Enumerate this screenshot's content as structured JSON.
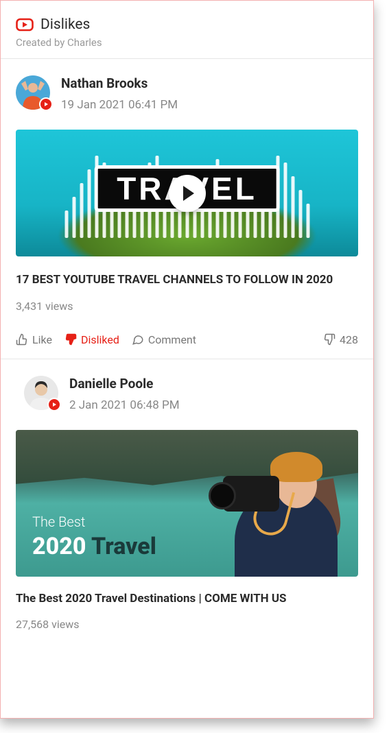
{
  "header": {
    "title": "Dislikes",
    "subtitle": "Created by Charles"
  },
  "posts": [
    {
      "author": "Nathan Brooks",
      "timestamp": "19 Jan 2021 06:41 PM",
      "thumb_word": "TRAVEL",
      "title": "17 BEST YOUTUBE TRAVEL CHANNELS TO FOLLOW IN 2020",
      "views": "3,431 views",
      "actions": {
        "like_label": "Like",
        "dislike_label": "Disliked",
        "comment_label": "Comment",
        "dislike_count": "428"
      }
    },
    {
      "author": "Danielle Poole",
      "timestamp": "2 Jan 2021 06:48 PM",
      "thumb_line1": "The Best",
      "thumb_line2a": "2020 ",
      "thumb_line2b": "Travel",
      "title": "The Best 2020 Travel Destinations | COME WITH US",
      "views": "27,568 views"
    }
  ]
}
